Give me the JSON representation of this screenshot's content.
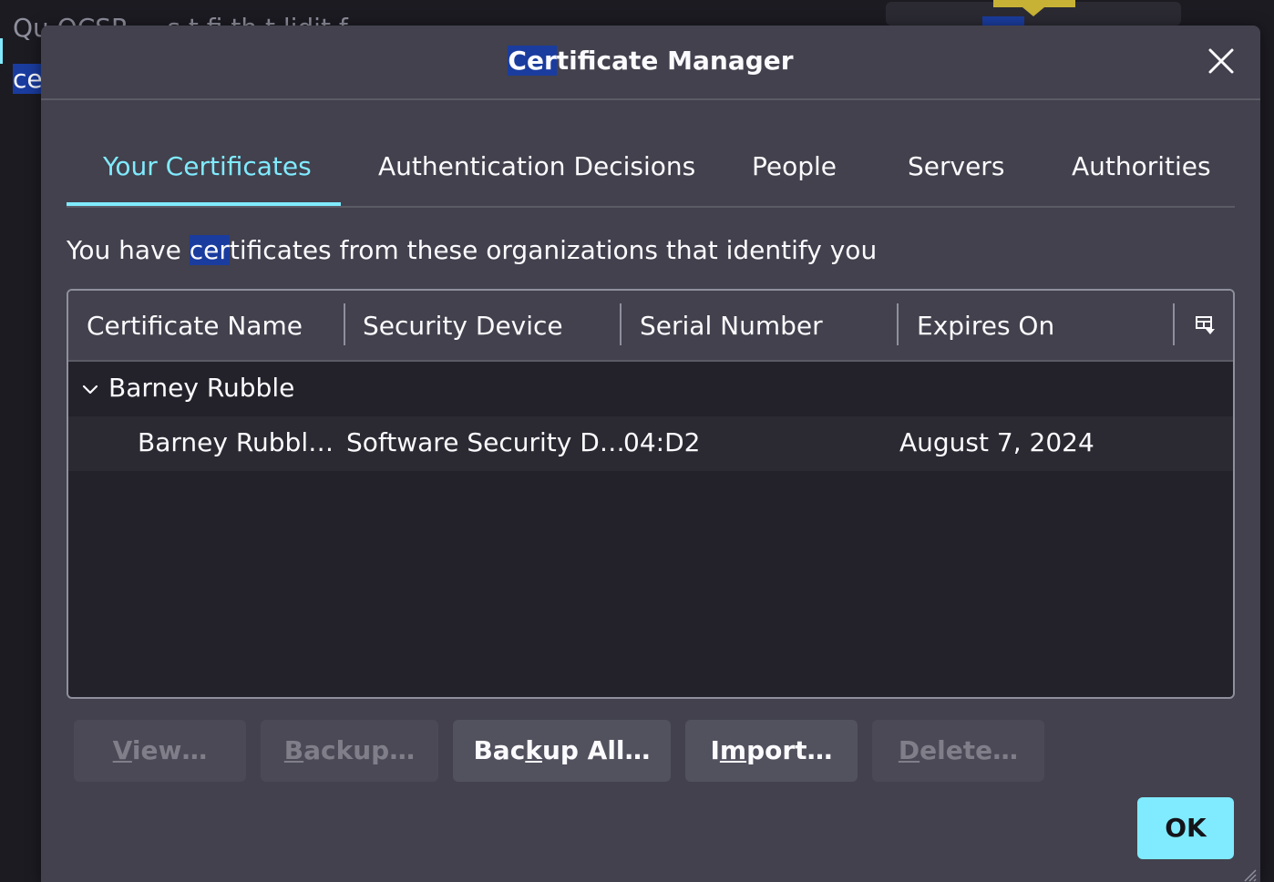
{
  "background": {
    "line1": "Qu    OCSP    ...    s    t    fi   th    t  lidit   f",
    "line2": "ce"
  },
  "dialog": {
    "title_highlight": "Cer",
    "title_rest": "tificate Manager",
    "close_icon": "close-icon"
  },
  "tabs": [
    {
      "label": "Your Certificates",
      "active": true
    },
    {
      "label": "Authentication Decisions",
      "active": false
    },
    {
      "label": "People",
      "active": false
    },
    {
      "label": "Servers",
      "active": false
    },
    {
      "label": "Authorities",
      "active": false
    }
  ],
  "description": {
    "before": "You have ",
    "highlight": "cer",
    "after": "tificates from these organizations that identify you"
  },
  "table": {
    "columns": [
      "Certificate Name",
      "Security Device",
      "Serial Number",
      "Expires On"
    ],
    "column_picker_icon": "column-picker-icon",
    "groups": [
      {
        "label": "Barney Rubble",
        "expanded": true,
        "rows": [
          {
            "name": "Barney Rubbl…",
            "device": "Software Security D…",
            "serial": "04:D2",
            "expires": "August 7, 2024"
          }
        ]
      }
    ]
  },
  "buttons": {
    "view": {
      "pre": "",
      "accel": "V",
      "post": "iew…",
      "enabled": false
    },
    "backup": {
      "pre": "",
      "accel": "B",
      "post": "ackup…",
      "enabled": false
    },
    "backup_all": {
      "pre": "Bac",
      "accel": "k",
      "post": "up All…",
      "enabled": true
    },
    "import": {
      "pre": "I",
      "accel": "m",
      "post": "port…",
      "enabled": true
    },
    "delete": {
      "pre": "",
      "accel": "D",
      "post": "elete…",
      "enabled": false
    },
    "ok": "OK"
  },
  "colors": {
    "accent": "#80ebff",
    "dialog_bg": "#42414d",
    "selection_highlight": "#1a3c9e"
  }
}
